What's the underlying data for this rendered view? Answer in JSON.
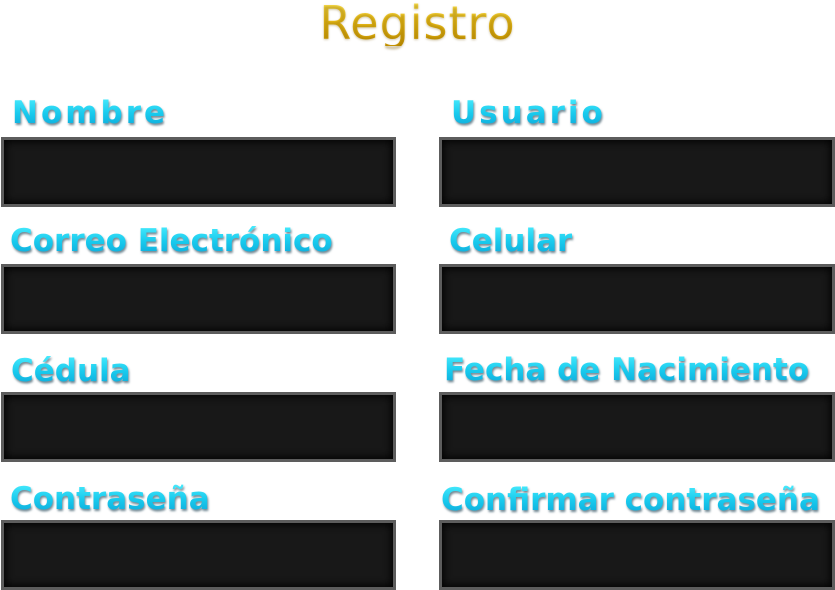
{
  "form": {
    "title": "Registro",
    "fields": [
      {
        "key": "nombre",
        "label": "Nombre",
        "value": ""
      },
      {
        "key": "usuario",
        "label": "Usuario",
        "value": ""
      },
      {
        "key": "correo",
        "label": "Correo Electrónico",
        "value": ""
      },
      {
        "key": "celular",
        "label": "Celular",
        "value": ""
      },
      {
        "key": "cedula",
        "label": "Cédula",
        "value": ""
      },
      {
        "key": "fecha_nacimiento",
        "label": "Fecha de Nacimiento",
        "value": ""
      },
      {
        "key": "contrasena",
        "label": "Contraseña",
        "value": ""
      },
      {
        "key": "confirmar_contrasena",
        "label": "Confirmar contraseña",
        "value": ""
      }
    ]
  },
  "colors": {
    "title": "#f3c51a",
    "label": "#1cc7ea",
    "input_background": "#181818",
    "input_border": "#5d5d5d",
    "page_background": "#ffffff"
  }
}
